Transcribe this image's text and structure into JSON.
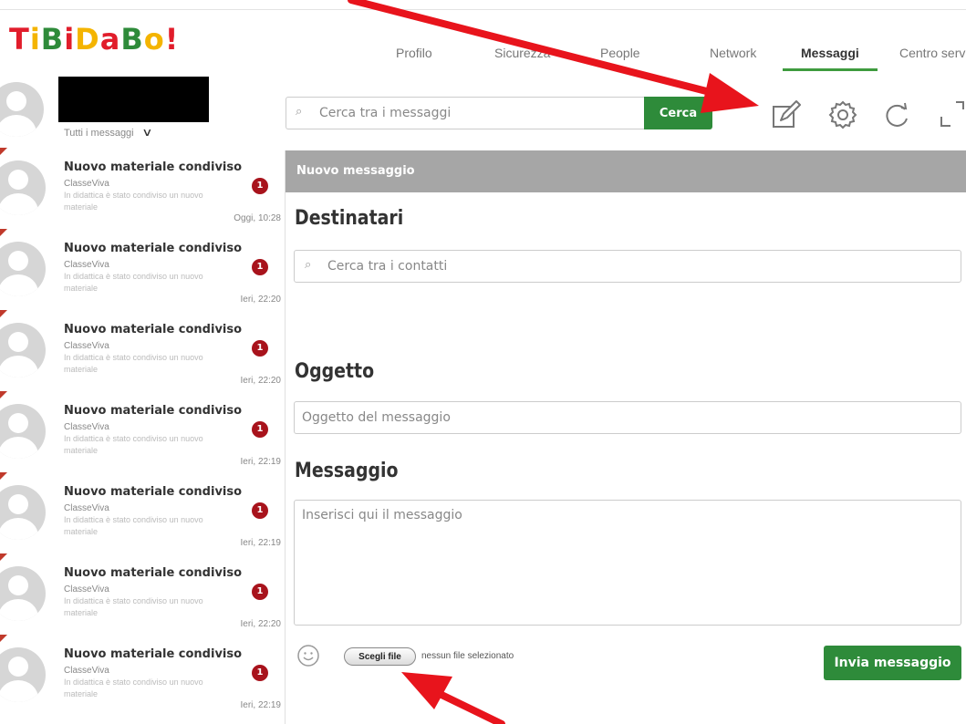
{
  "logo": {
    "text": [
      "T",
      "i",
      "B",
      "i",
      "D",
      "a",
      "B",
      "o",
      "!"
    ],
    "colors": [
      "#e11d2b",
      "#f4b400",
      "#2e8b3a",
      "#e11d2b",
      "#f4b400",
      "#e11d2b",
      "#2e8b3a",
      "#f4b400",
      "#e11d2b"
    ]
  },
  "nav": {
    "tabs": [
      {
        "label": "Profilo",
        "active": false
      },
      {
        "label": "Sicurezza",
        "active": false
      },
      {
        "label": "People",
        "active": false
      },
      {
        "label": "Network",
        "active": false
      },
      {
        "label": "Messaggi",
        "active": true
      },
      {
        "label": "Centro servizi",
        "active": false
      }
    ]
  },
  "sidebar": {
    "filter_label": "Tutti i messaggi",
    "messages": [
      {
        "title": "Nuovo materiale condiviso",
        "sender": "ClasseViva",
        "preview": "In didattica è stato condiviso un nuovo materiale",
        "badge": "1",
        "time": "Oggi, 10:28"
      },
      {
        "title": "Nuovo materiale condiviso",
        "sender": "ClasseViva",
        "preview": "In didattica è stato condiviso un nuovo materiale",
        "badge": "1",
        "time": "Ieri, 22:20"
      },
      {
        "title": "Nuovo materiale condiviso",
        "sender": "ClasseViva",
        "preview": "In didattica è stato condiviso un nuovo materiale",
        "badge": "1",
        "time": "Ieri, 22:20"
      },
      {
        "title": "Nuovo materiale condiviso",
        "sender": "ClasseViva",
        "preview": "In didattica è stato condiviso un nuovo materiale",
        "badge": "1",
        "time": "Ieri, 22:19"
      },
      {
        "title": "Nuovo materiale condiviso",
        "sender": "ClasseViva",
        "preview": "In didattica è stato condiviso un nuovo materiale",
        "badge": "1",
        "time": "Ieri, 22:19"
      },
      {
        "title": "Nuovo materiale condiviso",
        "sender": "ClasseViva",
        "preview": "In didattica è stato condiviso un nuovo materiale",
        "badge": "1",
        "time": "Ieri, 22:20"
      },
      {
        "title": "Nuovo materiale condiviso",
        "sender": "ClasseViva",
        "preview": "In didattica è stato condiviso un nuovo materiale",
        "badge": "1",
        "time": "Ieri, 22:19"
      }
    ]
  },
  "search": {
    "placeholder": "Cerca tra i messaggi",
    "button_label": "Cerca"
  },
  "toolbar": {
    "icons": [
      "compose-icon",
      "gear-icon",
      "refresh-icon",
      "expand-icon"
    ]
  },
  "compose": {
    "header": "Nuovo messaggio",
    "recipients_label": "Destinatari",
    "recipients_placeholder": "Cerca tra i contatti",
    "subject_label": "Oggetto",
    "subject_placeholder": "Oggetto del messaggio",
    "message_label": "Messaggio",
    "message_placeholder": "Inserisci qui il messaggio",
    "file_button_label": "Scegli file",
    "file_status": "nessun file selezionato",
    "send_label": "Invia messaggio"
  },
  "colors": {
    "accent_green": "#2e8b3a",
    "badge_red": "#a8131c",
    "arrow_red": "#e8141c",
    "header_gray": "#a6a6a6"
  }
}
